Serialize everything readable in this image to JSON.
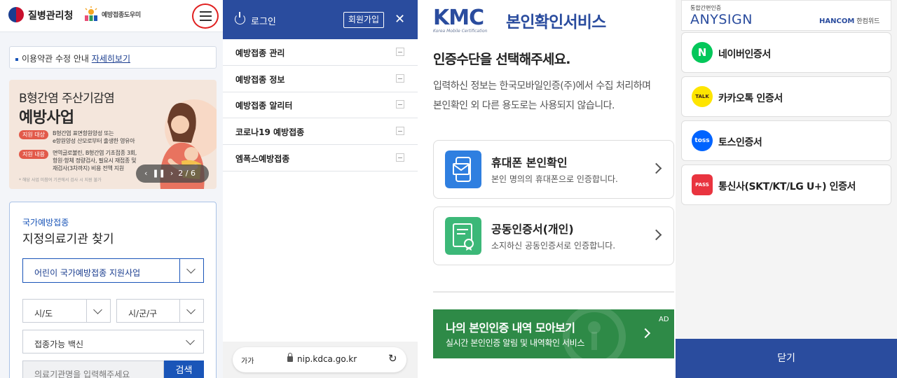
{
  "panel1": {
    "agency_name": "질병관리청",
    "campaign_logo": "예방접종도우미",
    "notice": {
      "text": "이용약관 수정 안내",
      "link": "자세히보기"
    },
    "banner": {
      "title_line1": "B형간염 주산기감염",
      "title_line2": "예방사업",
      "target_label": "지원 대상",
      "target_text_1": "B형간염 표면항원양성 또는",
      "target_text_2": "e항원양성 산모로부터 출생한 영유아",
      "content_label": "지원 내용",
      "content_text_1": "면역글로불린, B형간염 기초접종 3회,",
      "content_text_2": "항원·항체 정량검사, 필요시 재접종 및",
      "content_text_3": "재검사(3차까지) 비용 전액 지원",
      "footnote": "* 해당 사업 미참여 기관에서 검사 시 지원 불가",
      "slide_counter": "2 / 6"
    },
    "finder": {
      "subtitle": "국가예방접종",
      "title": "지정의료기관 찾기",
      "program_select": "어린이 국가예방접종 지원사업",
      "sido": "시/도",
      "sigungu": "시/군/구",
      "vaccine": "접종가능 백신",
      "search_placeholder": "의료기관명을 입력해주세요",
      "search_button": "검색"
    }
  },
  "panel2": {
    "login": "로그인",
    "join": "회원가입",
    "close": "✕",
    "menu": [
      "예방접종 관리",
      "예방접종 정보",
      "예방접종 알리터",
      "코로나19 예방접종",
      "엠폭스예방접종"
    ],
    "url_aa": "가가",
    "url": "nip.kdca.go.kr"
  },
  "panel3": {
    "logo": "KMC",
    "logo_sub": "Korea Mobile Certification",
    "title": "본인확인서비스",
    "heading": "인증수단을 선택해주세요.",
    "desc_line1": "입력하신 정보는 한국모바일인증(주)에서 수집 처리하며",
    "desc_line2": "본인확인 외 다른 용도로는 사용되지 않습니다.",
    "options": [
      {
        "title": "휴대폰 본인확인",
        "desc": "본인 명의의 휴대폰으로 인증합니다."
      },
      {
        "title": "공동인증서(개인)",
        "desc": "소지하신 공동인증서로 인증합니다."
      }
    ],
    "ad": {
      "title": "나의 본인인증 내역 모아보기",
      "desc": "실시간 본인인증 알림 및 내역확인 서비스",
      "badge": "AD"
    }
  },
  "panel4": {
    "header_small": "통합간편인증",
    "header_logo": "ANYSIGN",
    "hancom": "HANCOM",
    "hancom_kr": "한컴위드",
    "providers": [
      {
        "label": "네이버인증서",
        "icon": "N"
      },
      {
        "label": "카카오톡 인증서",
        "icon": "TALK"
      },
      {
        "label": "토스인증서",
        "icon": "toss"
      },
      {
        "label": "통신사(SKT/KT/LG U+) 인증서",
        "icon": "PASS"
      }
    ],
    "close": "닫기"
  },
  "colors": {
    "primary": "#2a4c9e",
    "kdca_blue": "#1a55b8",
    "ad_green": "#2e8a47",
    "naver": "#03c75a",
    "kakao": "#fee500",
    "toss": "#0064ff",
    "pass": "#e9343f"
  }
}
